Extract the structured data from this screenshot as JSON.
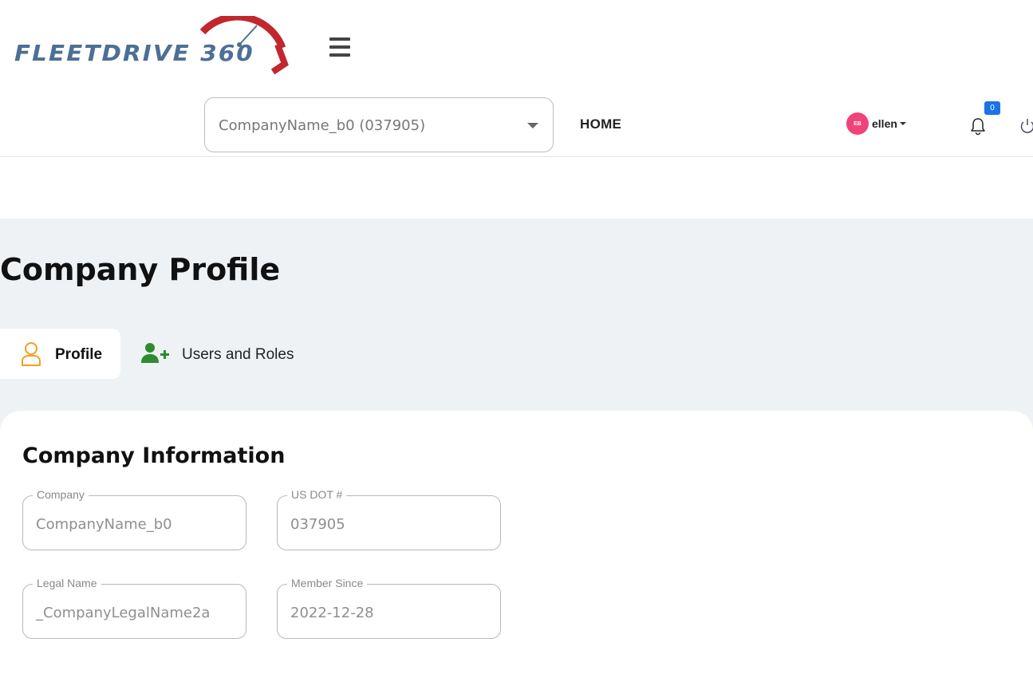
{
  "brand": {
    "logo_text": "FLEETDRIVE 360",
    "accent_color": "#c1272d",
    "text_color": "#4d6f95"
  },
  "header": {
    "company_selector": {
      "value": "CompanyName_b0 (037905)"
    },
    "home_label": "HOME",
    "user": {
      "initials": "EB",
      "name": "ellen"
    },
    "notifications": {
      "count": "0"
    }
  },
  "page": {
    "title": "Company Profile",
    "tabs": [
      {
        "label": "Profile",
        "icon": "user-icon",
        "active": true
      },
      {
        "label": "Users and Roles",
        "icon": "user-add-icon",
        "active": false
      }
    ]
  },
  "company_info": {
    "title": "Company Information",
    "fields": [
      {
        "label": "Company",
        "value": "CompanyName_b0"
      },
      {
        "label": "US DOT #",
        "value": "037905"
      },
      {
        "label": "Legal Name",
        "value": "_CompanyLegalName2a"
      },
      {
        "label": "Member Since",
        "value": "2022-12-28"
      }
    ]
  }
}
